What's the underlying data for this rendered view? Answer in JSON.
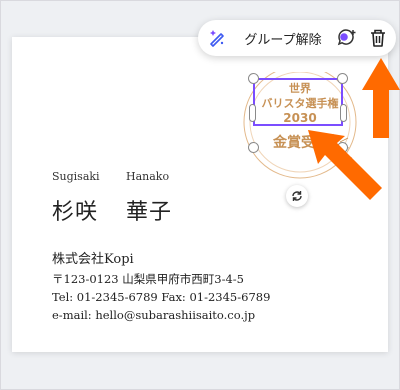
{
  "toolbar": {
    "ungroup_label": "グループ解除",
    "icons": [
      "magic-edit-icon",
      "comment-add-icon",
      "trash-icon"
    ]
  },
  "card": {
    "romaji_first": "Sugisaki",
    "romaji_last": "Hanako",
    "name_family": "杉咲",
    "name_given": "華子",
    "company": "株式会社Kopi",
    "address": "〒123-0123 山梨県甲府市西町3-4-5",
    "phone": "Tel: 01-2345-6789   Fax: 01-2345-6789",
    "email": "e-mail: hello@subarashiisaito.co.jp"
  },
  "award": {
    "line1": "世界",
    "line2": "バリスタ選手権",
    "line3": "2030",
    "line4": "金賞受"
  },
  "colors": {
    "selection": "#7b4dff",
    "arrow": "#ff6a00",
    "award_gold": "#c79155"
  }
}
